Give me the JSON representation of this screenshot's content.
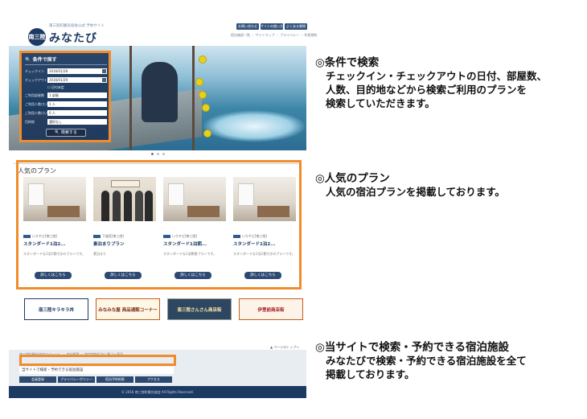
{
  "site": {
    "logo_mark": "南三陸",
    "logo_text": "みなたび",
    "logo_sub": "南三陸町観光協会公式 予約サイト",
    "header_buttons": [
      "お問い合わせ",
      "サイトの使い方",
      "よくある質問"
    ],
    "header_links": "宿泊施設一覧 ・ サイトマップ ・ プライバシー ・ 利用規約",
    "search": {
      "title": "条件で探す",
      "rows": [
        {
          "label": "チェックイン",
          "value": "2016/01/28"
        },
        {
          "label": "チェックアウト",
          "value": "2016/01/29"
        },
        {
          "label": "ご利用部屋数",
          "value": "1 部屋"
        },
        {
          "label": "ご利用人数/大人",
          "value": "1 人"
        },
        {
          "label": "ご利用人数/小人",
          "value": "0 人"
        },
        {
          "label": "目的地",
          "value": "選択なし"
        }
      ],
      "checkbox_label": "日付未定",
      "button_label": "検索する"
    },
    "plans_title": "人気のプラン",
    "plans": [
      {
        "tag": "いりやど[南三陸]",
        "name": "スタンダード1泊2...",
        "desc": "スタンダードな1泊2食付きのプランです。",
        "button": "詳しくはこちら"
      },
      {
        "tag": "下道荘[南三陸]",
        "name": "素泊まりプラン",
        "desc": "素泊まり",
        "button": "詳しくはこちら"
      },
      {
        "tag": "いりやど[南三陸]",
        "name": "スタンダード1泊朝...",
        "desc": "スタンダードな1泊朝食プランです。",
        "button": "詳しくはこちら"
      },
      {
        "tag": "いりやど[南三陸]",
        "name": "スタンダード1泊2...",
        "desc": "スタンダードな1泊2食付きのプランです。",
        "button": "詳しくはこちら"
      }
    ],
    "banners": [
      "南三陸キラキラ丼",
      "みなみな屋 商品通販コーナー",
      "南三陸さんさん商店街",
      "伊里前商店街"
    ],
    "pagetop": "▲ ページのトップへ",
    "footer_links": "南三陸町観光協会のページへ ・ 会社概要 ・ 特定商取引法に基づく表記",
    "footer_highlight": "当サイトで検索・予約できる宿泊施設",
    "footer_tabs": [
      "会員登録",
      "プライバシーポリシー",
      "宿泊予約約款",
      "アクセス"
    ],
    "copyright": "© 2016 南三陸町観光協会 All Rights Reserved."
  },
  "notes": [
    {
      "heading": "◎条件で検索",
      "lines": [
        "チェックイン・チェックアウトの日付、部屋数、",
        "人数、目的地などから検索ご利用のプランを",
        "検索していただきます。"
      ]
    },
    {
      "heading": "◎人気のプラン",
      "lines": [
        "人気の宿泊プランを掲載しております。"
      ]
    },
    {
      "heading": "◎当サイトで検索・予約できる宿泊施設",
      "lines": [
        "みなたびで検索・予約できる宿泊施設を全て",
        "掲載しております。"
      ]
    }
  ],
  "colors": {
    "frame": "#f28c2b",
    "brand": "#1d3a63"
  }
}
